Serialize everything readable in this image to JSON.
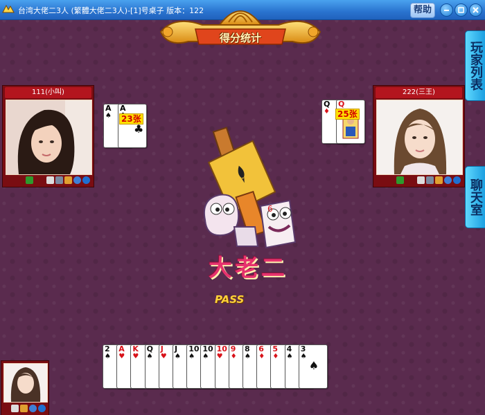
{
  "window": {
    "title": "台湾大佬二3人 (繁體大佬二3人)-[1]号桌子 版本：122",
    "help_label": "帮助",
    "min_icon": "minimize-icon",
    "max_icon": "maximize-icon",
    "close_icon": "close-icon"
  },
  "score_banner": {
    "label": "得分统计"
  },
  "side_tabs": {
    "player_list": "玩家列表",
    "chat_room": "聊天室"
  },
  "players": {
    "left": {
      "name": "111(小叫)",
      "badge": "23张",
      "played": [
        {
          "rank": "A",
          "suit": "♠",
          "color": "black"
        },
        {
          "rank": "A",
          "suit": "♣",
          "color": "black"
        }
      ]
    },
    "right": {
      "name": "222(三王)",
      "badge": "25张",
      "played": [
        {
          "rank": "Q",
          "suit": "♦",
          "color": "red"
        },
        {
          "rank": "Q",
          "suit": "♦",
          "color": "red"
        }
      ]
    }
  },
  "logo_text": "大老二",
  "status_text": "PASS",
  "hand": [
    {
      "rank": "2",
      "suit": "♠",
      "color": "black"
    },
    {
      "rank": "A",
      "suit": "♥",
      "color": "red"
    },
    {
      "rank": "K",
      "suit": "♥",
      "color": "red"
    },
    {
      "rank": "Q",
      "suit": "♠",
      "color": "black"
    },
    {
      "rank": "J",
      "suit": "♥",
      "color": "red"
    },
    {
      "rank": "J",
      "suit": "♠",
      "color": "black"
    },
    {
      "rank": "10",
      "suit": "♠",
      "color": "black"
    },
    {
      "rank": "10",
      "suit": "♠",
      "color": "black"
    },
    {
      "rank": "10",
      "suit": "♥",
      "color": "red"
    },
    {
      "rank": "9",
      "suit": "♦",
      "color": "red"
    },
    {
      "rank": "8",
      "suit": "♠",
      "color": "black"
    },
    {
      "rank": "6",
      "suit": "♦",
      "color": "red"
    },
    {
      "rank": "5",
      "suit": "♦",
      "color": "red"
    },
    {
      "rank": "4",
      "suit": "♠",
      "color": "black"
    },
    {
      "rank": "3",
      "suit": "♠",
      "color": "black"
    }
  ]
}
